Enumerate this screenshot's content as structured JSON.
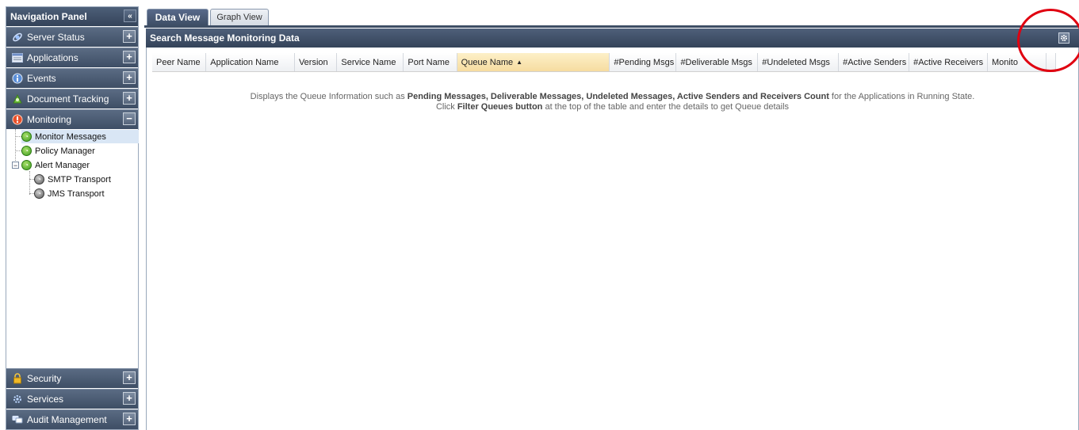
{
  "nav": {
    "title": "Navigation Panel",
    "top_sections": [
      {
        "label": "Server Status",
        "icon": "server-status-icon"
      },
      {
        "label": "Applications",
        "icon": "applications-icon"
      },
      {
        "label": "Events",
        "icon": "events-icon"
      },
      {
        "label": "Document Tracking",
        "icon": "document-tracking-icon"
      },
      {
        "label": "Monitoring",
        "icon": "monitoring-icon",
        "expanded": true
      }
    ],
    "tree": [
      {
        "label": "Monitor Messages",
        "icon": "status-green-icon",
        "selected": true
      },
      {
        "label": "Policy Manager",
        "icon": "status-green-icon"
      },
      {
        "label": "Alert Manager",
        "icon": "status-green-icon",
        "expanded": true
      },
      {
        "label": "SMTP Transport",
        "icon": "status-gray-icon"
      },
      {
        "label": "JMS Transport",
        "icon": "status-gray-icon"
      }
    ],
    "bottom_sections": [
      {
        "label": "Security",
        "icon": "lock-icon"
      },
      {
        "label": "Services",
        "icon": "services-icon"
      },
      {
        "label": "Audit Management",
        "icon": "audit-icon"
      }
    ]
  },
  "tabs": [
    {
      "label": "Data View",
      "active": true
    },
    {
      "label": "Graph View",
      "active": false
    }
  ],
  "panel": {
    "title": "Search Message Monitoring Data"
  },
  "grid": {
    "columns": [
      "Peer Name",
      "Application Name",
      "Version",
      "Service Name",
      "Port Name",
      "Queue Name",
      "#Pending Msgs",
      "#Deliverable Msgs",
      "#Undeleted Msgs",
      "#Active Senders",
      "#Active Receivers",
      "Monito"
    ],
    "sorted_column": "Queue Name",
    "sort_direction": "ascending"
  },
  "empty_message": {
    "line1_pre": "Displays the Queue Information such as ",
    "line1_bold": "Pending Messages, Deliverable Messages, Undeleted Messages, Active Senders and Receivers Count",
    "line1_post": " for the Applications in Running State.",
    "line2_pre": "Click ",
    "line2_bold": "Filter Queues button",
    "line2_post": " at the top of the table and enter the details to get Queue details"
  },
  "colors": {
    "header_dark": "#3e4e65",
    "annotation": "#e00010"
  }
}
